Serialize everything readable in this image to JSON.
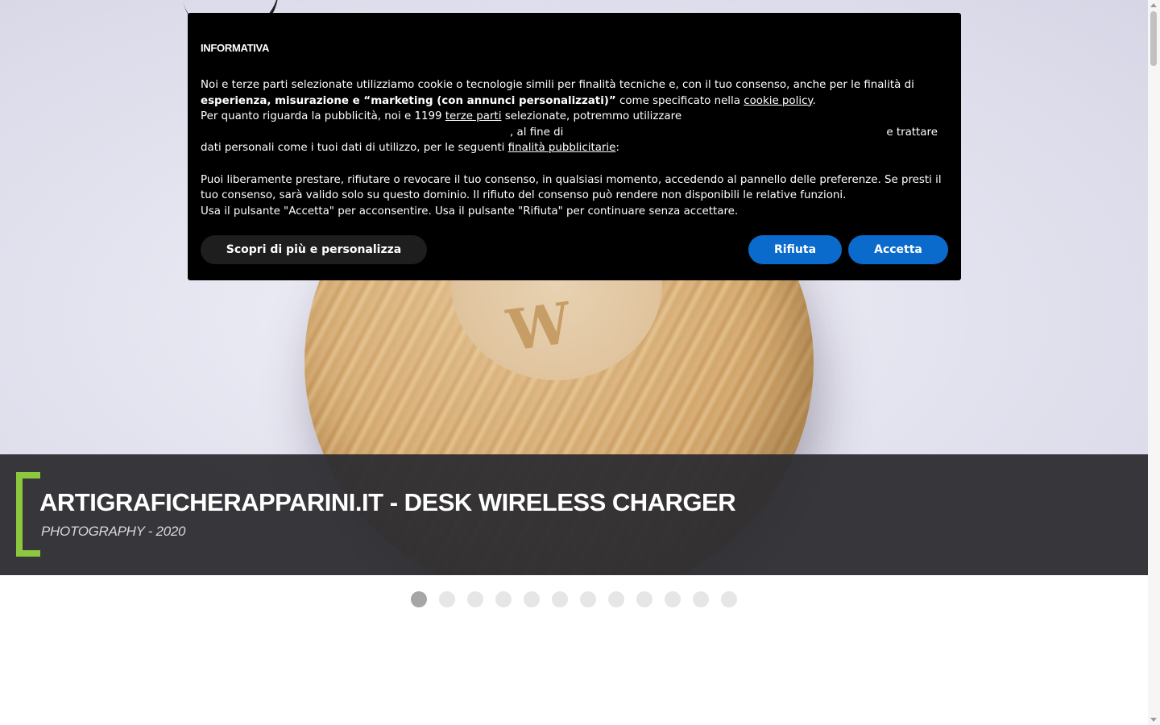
{
  "cookie_notice": {
    "title": "INFORMATIVA",
    "line1_a": "Noi e terze parti selezionate utilizziamo cookie o tecnologie simili per finalità tecniche e, con il tuo consenso, anche per le finalità di",
    "line1_bold": "esperienza, misurazione e “marketing (con annunci personalizzati)”",
    "line1_b": " come specificato nella ",
    "cookie_policy_link": "cookie policy",
    "line1_end": ".",
    "line2_a": "Per quanto riguarda la pubblicità, noi e 1199 ",
    "third_parties_link": "terze parti",
    "line2_b": " selezionate, potremmo utilizzare",
    "line3_a": ", al fine di",
    "line3_b": "e trattare",
    "line4_a": "dati personali come i tuoi dati di utilizzo, per le seguenti ",
    "ad_purposes_link": "finalità pubblicitarie",
    "line4_end": ":",
    "para2": "Puoi liberamente prestare, rifiutare o revocare il tuo consenso, in qualsiasi momento, accedendo al pannello delle preferenze. Se presti il tuo consenso, sarà valido solo su questo dominio. Il rifiuto del consenso può rendere non disponibili le relative funzioni.",
    "para3": "Usa il pulsante \"Accetta\" per acconsentire. Usa il pulsante \"Rifiuta\" per continuare senza accettare.",
    "btn_more": "Scopri di più e personalizza",
    "btn_reject": "Rifiuta",
    "btn_accept": "Accetta",
    "button_color": "#0b6bcd"
  },
  "slide": {
    "title": "ARTIGRAFICHERAPPARINI.IT - DESK WIRELESS CHARGER",
    "subtitle": "PHOTOGRAPHY - 2020",
    "accent_color": "#8dc63f",
    "image": "bamboo-wireless-charger-photo"
  },
  "slider": {
    "total_slides": 12,
    "active_index": 0
  }
}
